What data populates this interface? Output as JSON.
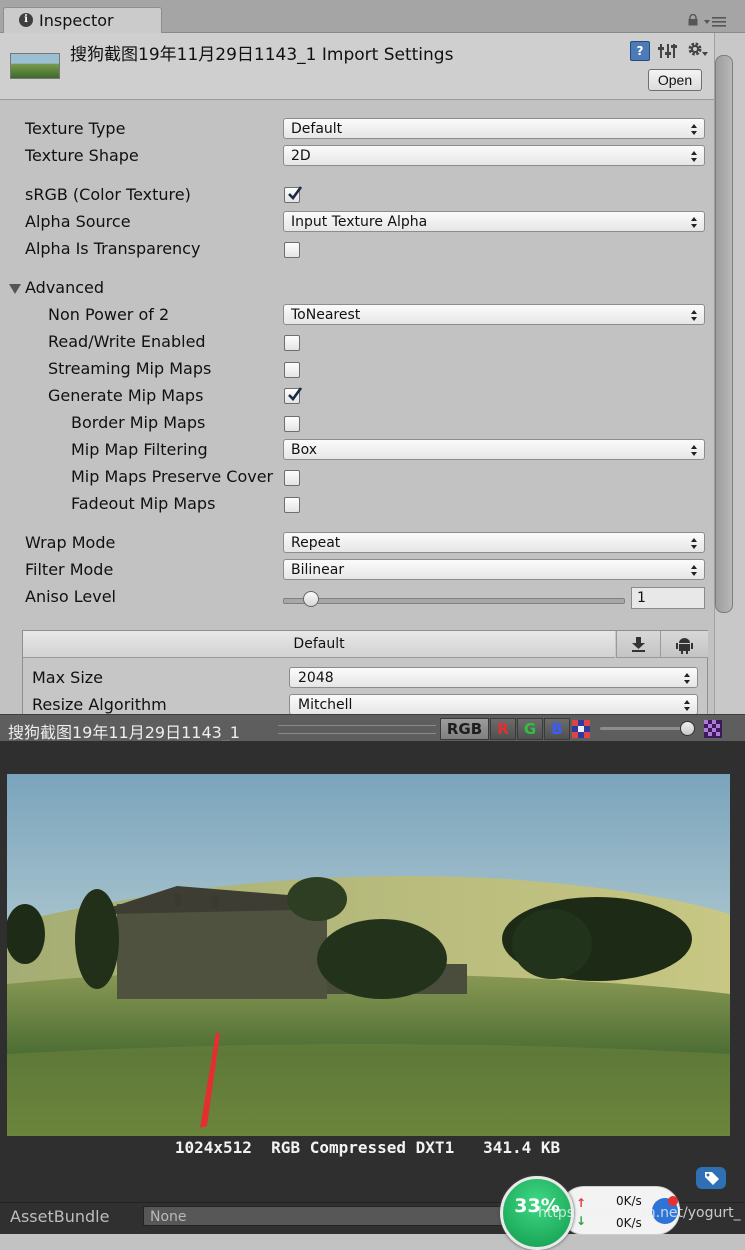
{
  "window": {
    "tab_label": "Inspector"
  },
  "header": {
    "title": "搜狗截图19年11月29日1143_1 Import Settings",
    "help_glyph": "?",
    "open_label": "Open"
  },
  "settings": {
    "texture_type_label": "Texture Type",
    "texture_type_value": "Default",
    "texture_shape_label": "Texture Shape",
    "texture_shape_value": "2D",
    "srgb_label": "sRGB (Color Texture)",
    "srgb_checked": true,
    "alpha_source_label": "Alpha Source",
    "alpha_source_value": "Input Texture Alpha",
    "alpha_transparency_label": "Alpha Is Transparency",
    "alpha_transparency_checked": false,
    "advanced_label": "Advanced",
    "npot_label": "Non Power of 2",
    "npot_value": "ToNearest",
    "read_write_label": "Read/Write Enabled",
    "read_write_checked": false,
    "streaming_mip_label": "Streaming Mip Maps",
    "streaming_mip_checked": false,
    "generate_mip_label": "Generate Mip Maps",
    "generate_mip_checked": true,
    "border_mip_label": "Border Mip Maps",
    "border_mip_checked": false,
    "mip_filtering_label": "Mip Map Filtering",
    "mip_filtering_value": "Box",
    "mip_coverage_label": "Mip Maps Preserve Cover",
    "mip_coverage_checked": false,
    "fadeout_mip_label": "Fadeout Mip Maps",
    "fadeout_mip_checked": false,
    "wrap_mode_label": "Wrap Mode",
    "wrap_mode_value": "Repeat",
    "filter_mode_label": "Filter Mode",
    "filter_mode_value": "Bilinear",
    "aniso_label": "Aniso Level",
    "aniso_value": "1",
    "aniso_level_fraction": 0.06
  },
  "platform": {
    "default_tab_label": "Default",
    "download_icon": "download-icon",
    "android_icon": "android-icon",
    "max_size_label": "Max Size",
    "max_size_value": "2048",
    "resize_label": "Resize Algorithm",
    "resize_value": "Mitchell"
  },
  "preview": {
    "name": "搜狗截图19年11月29日1143_1",
    "rgb_label": "RGB",
    "r_label": "R",
    "g_label": "G",
    "b_label": "B",
    "info": "1024x512  RGB Compressed DXT1   341.4 KB",
    "mip_level_fraction": 1.0
  },
  "assetbundle": {
    "label": "AssetBundle",
    "value": "None"
  },
  "network": {
    "percent": "33%",
    "up_speed": "0K/s",
    "down_speed": "0K/s"
  },
  "watermark": "https://blog.csdn.net/yogurt_",
  "colors": {
    "checkmark": "#3b5a8c",
    "r_channel": "#e03030",
    "g_channel": "#30c040",
    "b_channel": "#3a5cff",
    "network_green": "#1fb360"
  }
}
